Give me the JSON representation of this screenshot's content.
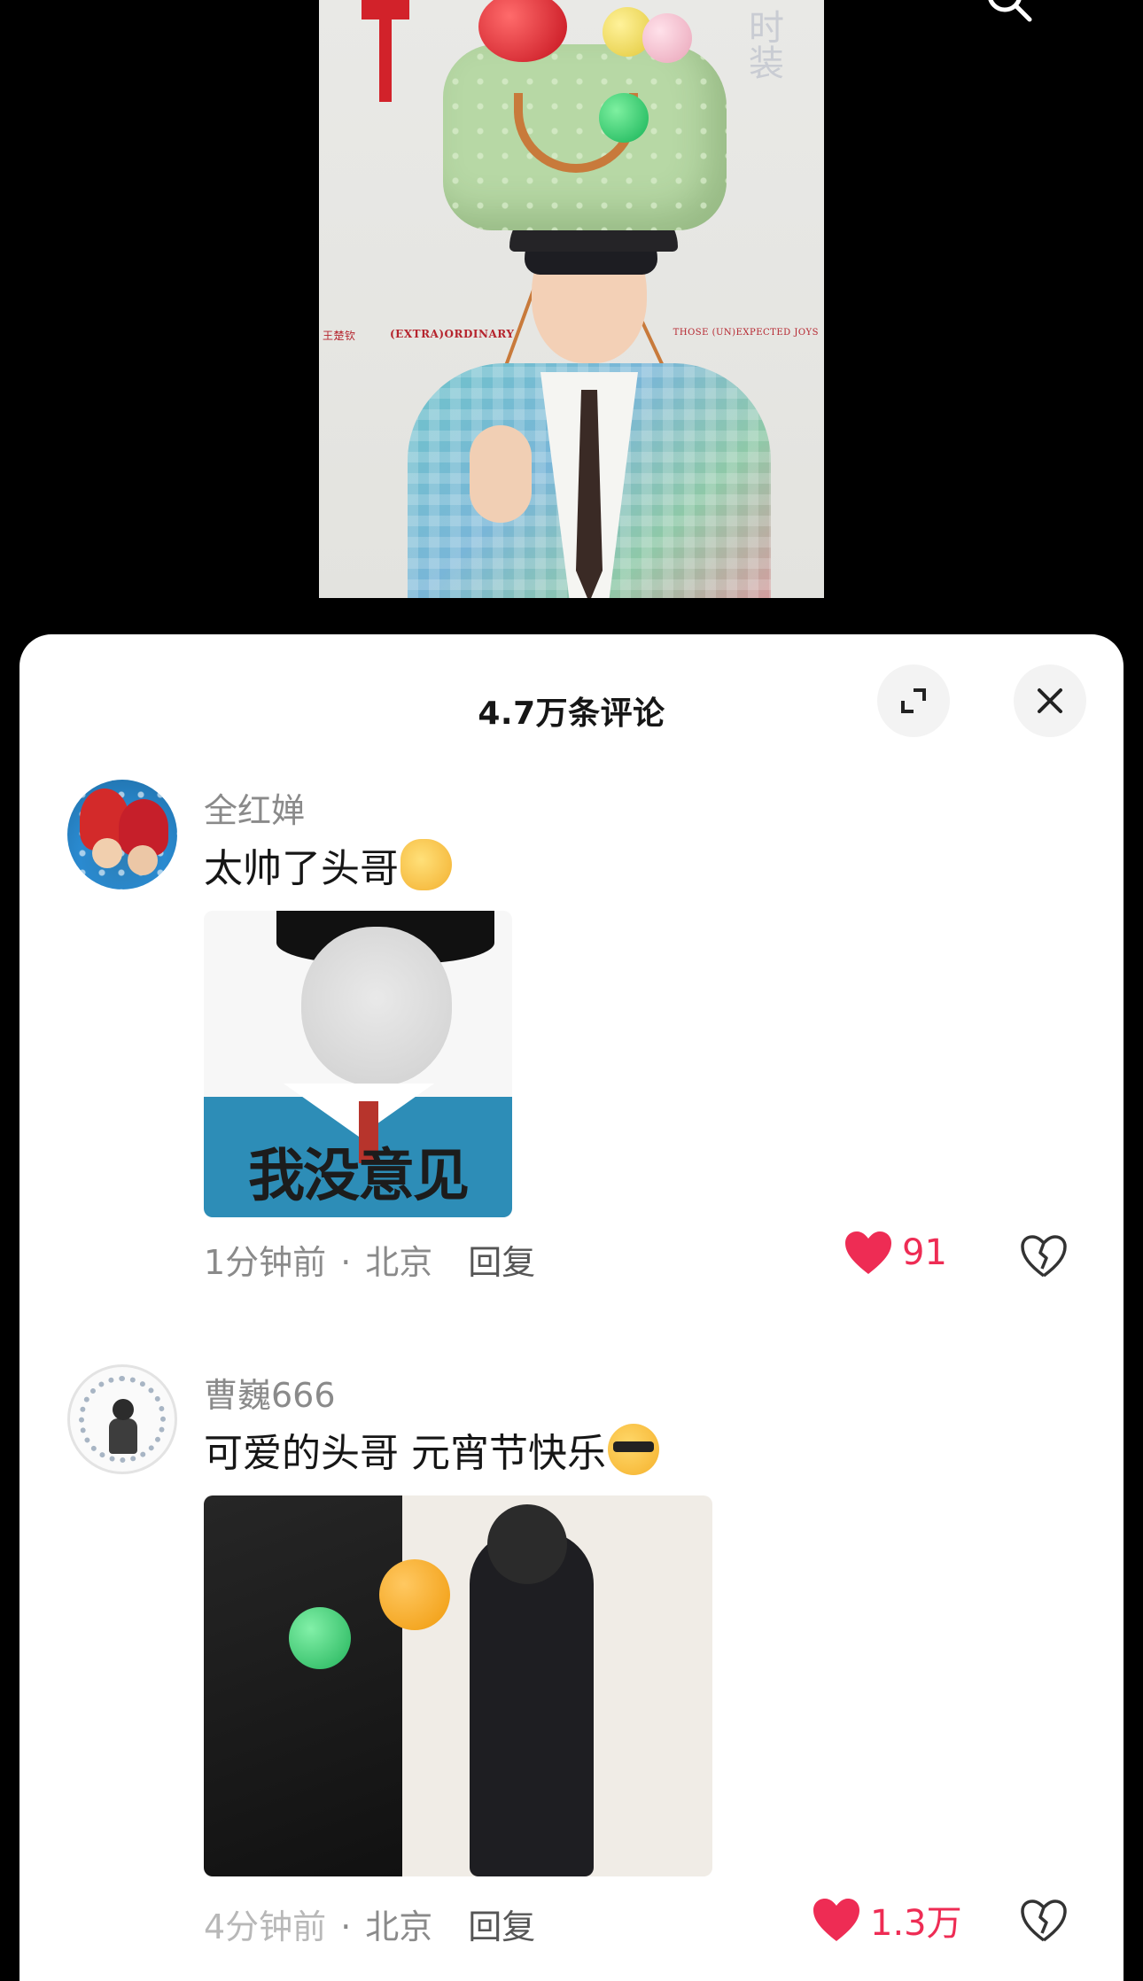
{
  "cover": {
    "left_text": "王楚钦",
    "center_text": "(EXTRA)ORDINARY",
    "right_text": "THOSE (UN)EXPECTED JOYS",
    "side_text": "时装"
  },
  "comments_panel": {
    "title": "4.7万条评论",
    "expand_icon": "expand-icon",
    "close_icon": "close-icon"
  },
  "comments": [
    {
      "username": "全红婵",
      "text": "太帅了头哥",
      "emoji": "clapping-hands",
      "image_caption": "我没意见",
      "time": "1分钟前",
      "location": "北京",
      "reply_label": "回复",
      "likes": "91",
      "liked": true
    },
    {
      "username": "曹巍666",
      "text": "可爱的头哥 元宵节快乐",
      "emoji": "cool-sunglasses",
      "time": "4分钟前",
      "location": "北京",
      "reply_label": "回复",
      "likes": "1.3万",
      "liked": true
    }
  ],
  "colors": {
    "like_red": "#ee2c54",
    "muted_text": "#8a8a8a",
    "panel_bg": "#ffffff",
    "video_bg": "#000000"
  }
}
